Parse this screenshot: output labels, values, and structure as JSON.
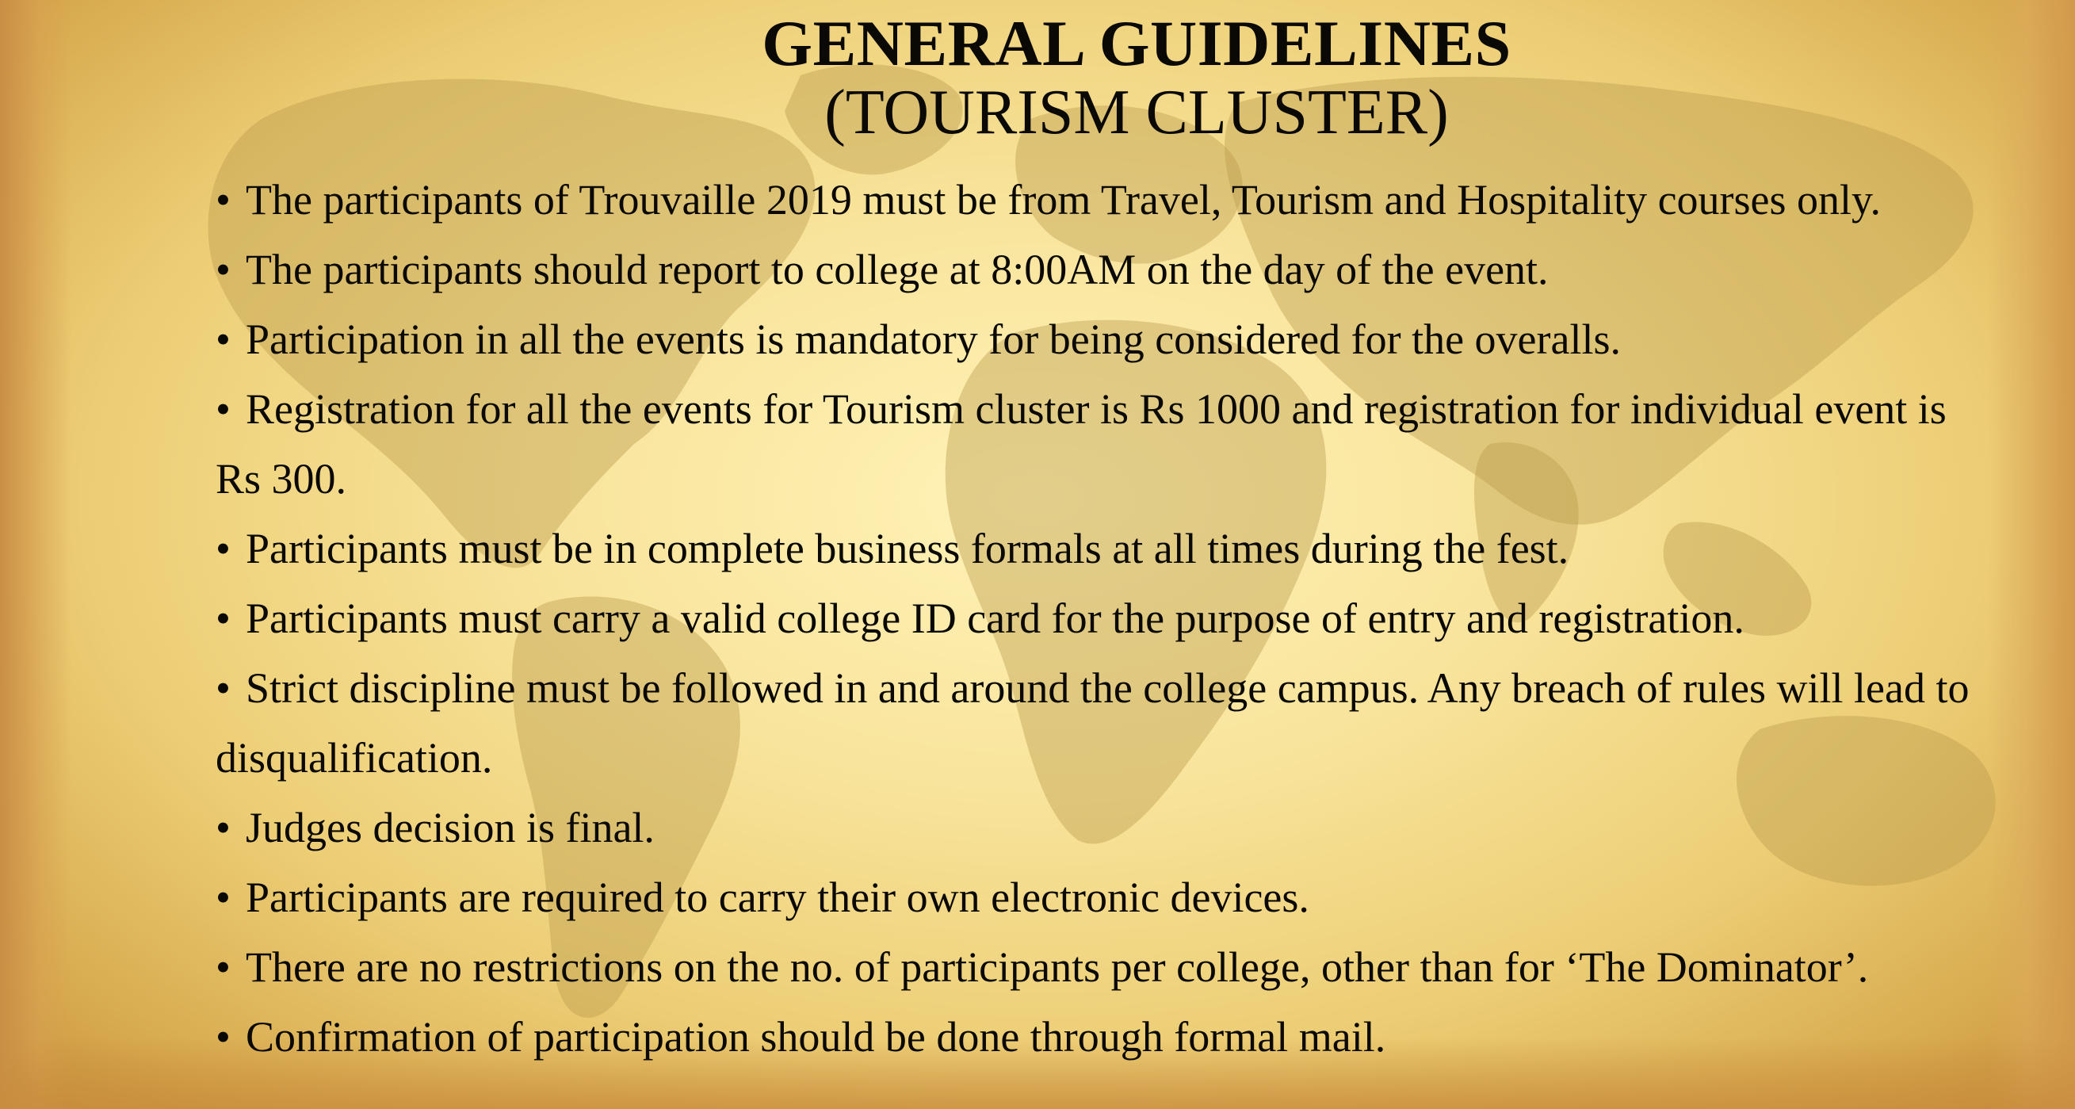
{
  "title": {
    "main": "GENERAL GUIDELINES",
    "sub": "(TOURISM CLUSTER)"
  },
  "bullet_char": "•",
  "guidelines": [
    "The participants of Trouvaille 2019 must be from Travel, Tourism and Hospitality courses only.",
    "The participants should report to college at 8:00AM on the day of the event.",
    "Participation in all the events is mandatory for being considered for the overalls.",
    "Registration for all the events for Tourism cluster is Rs 1000 and registration for individual event is Rs 300.",
    "Participants must be in complete business formals at all times during the fest.",
    "Participants must carry a valid college ID card for the purpose of entry and registration.",
    "Strict discipline must be followed in and around the college campus. Any breach of rules will lead to disqualification.",
    "Judges decision is final.",
    "Participants are required to carry their own electronic devices.",
    "There are no restrictions on the no. of participants per college, other than for ‘The Dominator’.",
    "Confirmation of participation should be done through formal mail."
  ],
  "colors": {
    "parchment": "#f8e39a",
    "map_silhouette": "#c9ab5c",
    "text": "#0b0906"
  }
}
